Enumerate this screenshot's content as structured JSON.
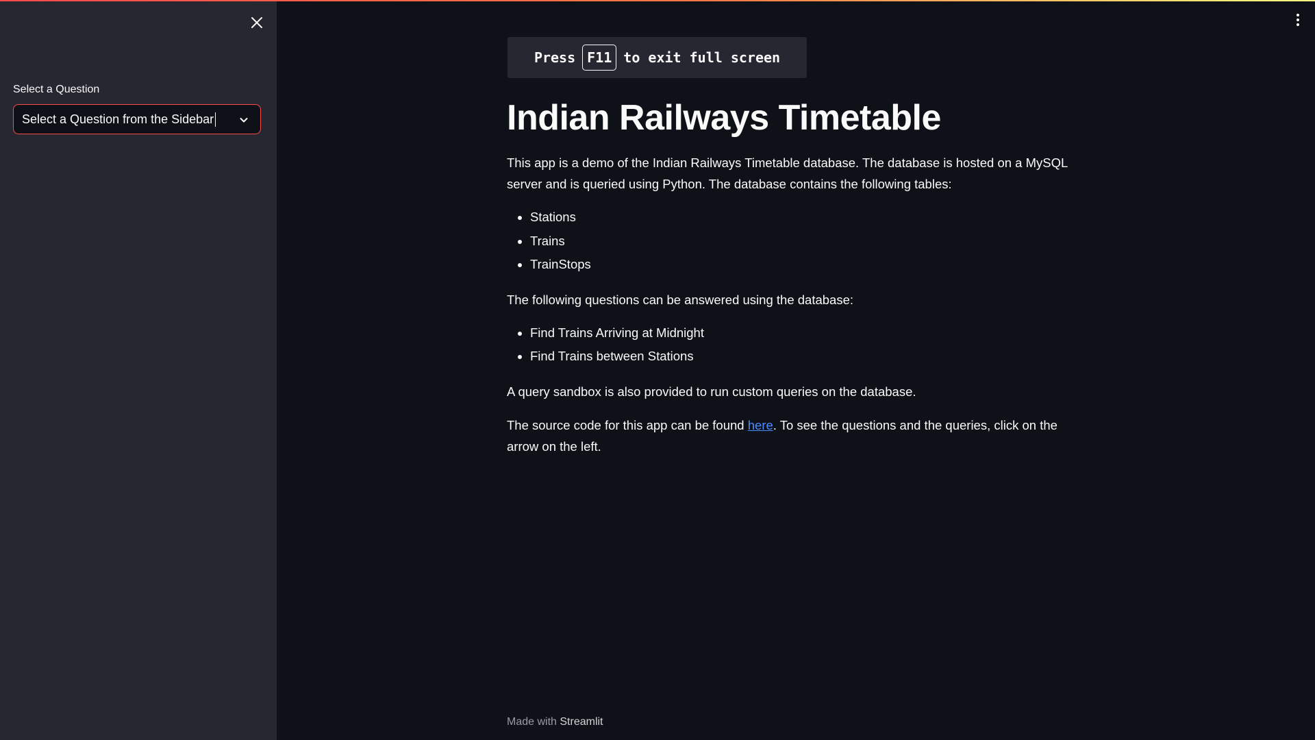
{
  "sidebar": {
    "label": "Select a Question",
    "select": {
      "value": "Select a Question from the Sidebar"
    },
    "close_icon": "close-icon",
    "chevron_icon": "chevron-down-icon"
  },
  "toast": {
    "prefix": "Press",
    "key": "F11",
    "suffix": "to exit full screen"
  },
  "main": {
    "title": "Indian Railways Timetable",
    "intro": "This app is a demo of the Indian Railways Timetable database. The database is hosted on a MySQL server and is queried using Python. The database contains the following tables:",
    "tables": [
      "Stations",
      "Trains",
      "TrainStops"
    ],
    "questions_intro": "The following questions can be answered using the database:",
    "questions": [
      "Find Trains Arriving at Midnight",
      "Find Trains between Stations"
    ],
    "sandbox": "A query sandbox is also provided to run custom queries on the database.",
    "source_prefix": "The source code for this app can be found ",
    "source_link": "here",
    "source_suffix": ". To see the questions and the queries, click on the arrow on the left."
  },
  "footer": {
    "prefix": "Made with",
    "brand": "Streamlit"
  },
  "colors": {
    "background": "#0e1117",
    "sidebar": "#262730",
    "accent": "#ff4b4b",
    "link": "#4a8cff"
  }
}
